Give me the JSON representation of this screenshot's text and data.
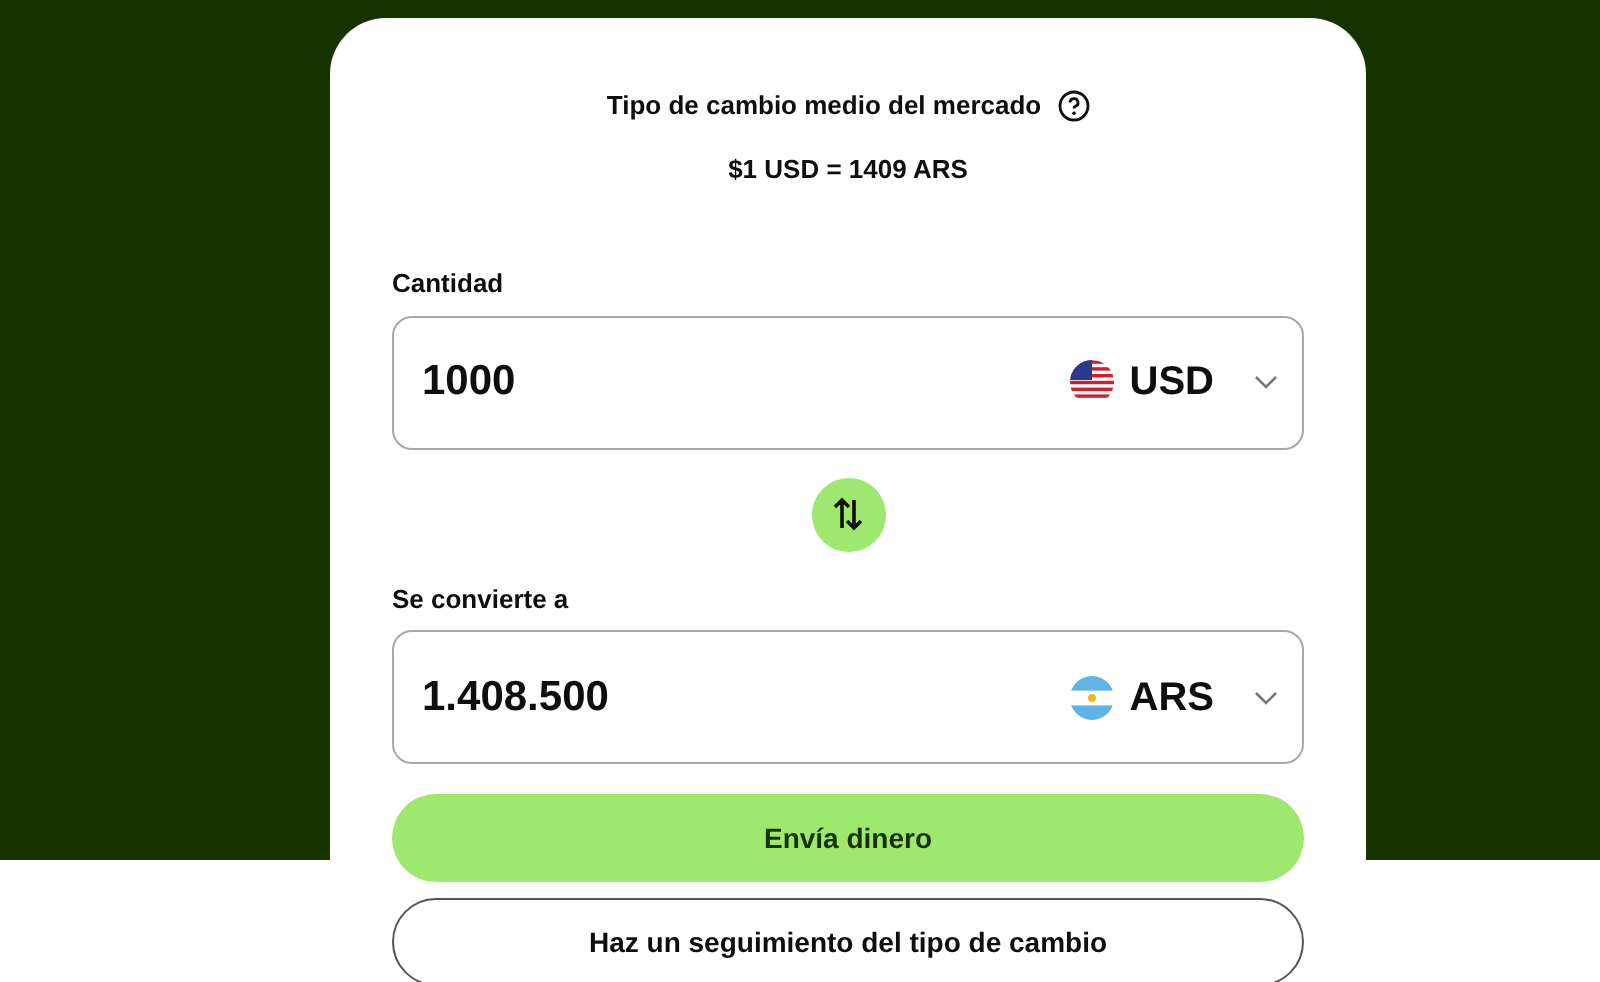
{
  "rate_header": {
    "title": "Tipo de cambio medio del mercado",
    "rate": "$1 USD = 1409 ARS"
  },
  "fields": [
    {
      "label": "Cantidad",
      "value": "1000",
      "currency": "USD",
      "kind": "us"
    },
    {
      "label": "Se convierte a",
      "value": "1.408.500",
      "currency": "ARS",
      "kind": "ar"
    }
  ],
  "buttons": [
    {
      "label": "Envía dinero",
      "kind": "primary"
    },
    {
      "label": "Haz un seguimiento del tipo de cambio",
      "kind": "outline"
    }
  ]
}
